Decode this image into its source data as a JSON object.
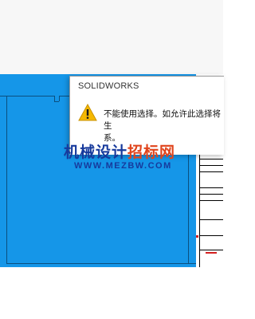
{
  "dialog": {
    "title": "SOLIDWORKS",
    "message": "不能使用选择。如允许此选择将生\n系。",
    "icon": "warning-icon"
  },
  "watermark": {
    "site_name_part1": "机械设计",
    "site_name_part2": "招标网",
    "url": "WWW.MEZBW.COM"
  },
  "colors": {
    "sheet_blue": "#1596e8",
    "warning_yellow": "#f5b800",
    "watermark_blue": "#173a9c",
    "watermark_red": "#e0441c"
  }
}
